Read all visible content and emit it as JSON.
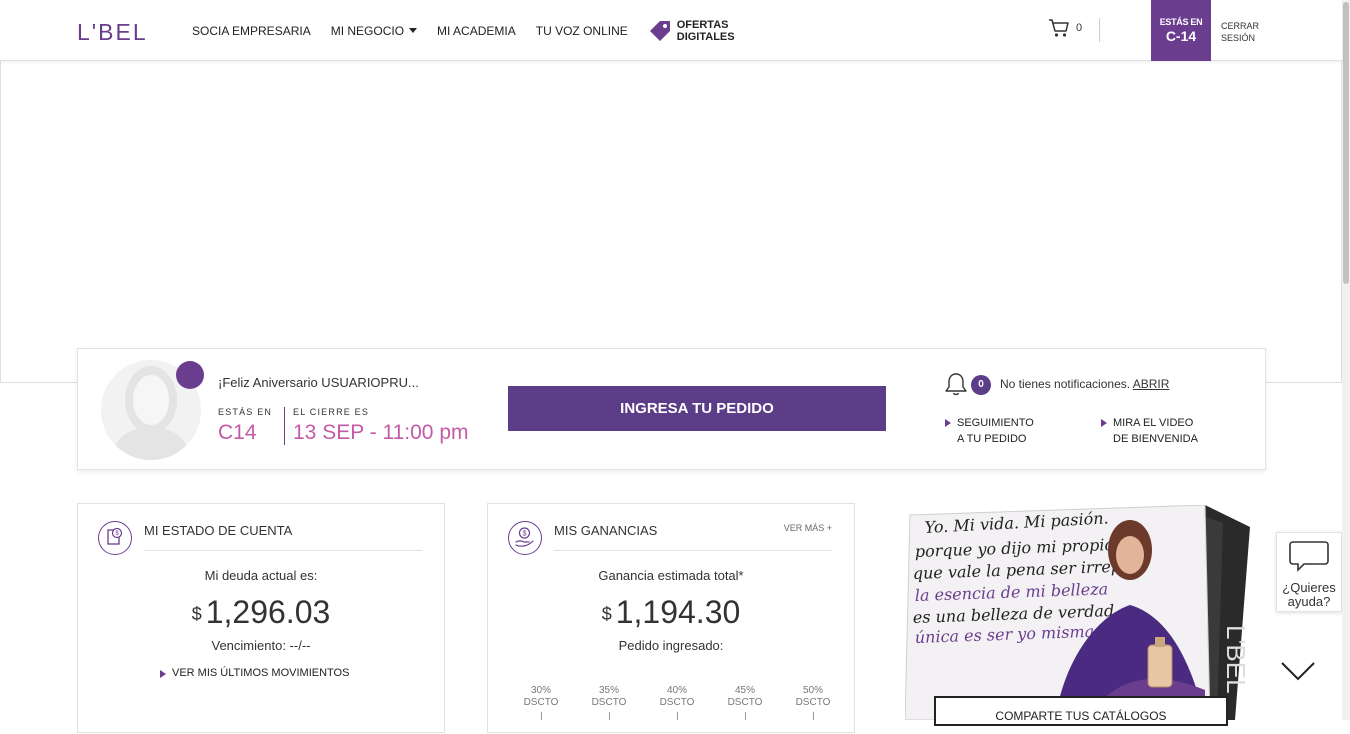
{
  "header": {
    "logo": "L'BEL",
    "nav": {
      "socia": "SOCIA EMPRESARIA",
      "negocio": "MI NEGOCIO",
      "academia": "MI ACADEMIA",
      "voz": "TU VOZ ONLINE",
      "ofertas_line1": "OFERTAS",
      "ofertas_line2": "DIGITALES"
    },
    "cart_count": "0",
    "campaign_label": "ESTÁS EN",
    "campaign_value": "C-14",
    "logout_line1": "CERRAR",
    "logout_line2": "SESIÓN",
    "colors": {
      "brand": "#6a3d8f",
      "accent_pink": "#c45aa5"
    }
  },
  "banner": {
    "slides": 5,
    "active_slide": 1
  },
  "profile": {
    "greeting": "¡Feliz Aniversario USUARIOPRU...",
    "estas_en_label": "ESTÁS EN",
    "campaign": "C14",
    "cierre_label": "EL CIERRE ES",
    "cierre_value": "13 SEP - 11:00 pm",
    "order_button": "INGRESA TU PEDIDO",
    "notif_count": "0",
    "notif_text": "No tienes notificaciones.",
    "notif_link": "ABRIR",
    "link_seguimiento_1": "SEGUIMIENTO",
    "link_seguimiento_2": "A TU PEDIDO",
    "link_video_1": "MIRA EL VIDEO",
    "link_video_2": "DE BIENVENIDA"
  },
  "estado": {
    "title": "MI ESTADO DE CUENTA",
    "debt_label": "Mi deuda actual es:",
    "currency": "$",
    "amount": "1,296.03",
    "due": "Vencimiento: --/--",
    "moves_link": "VER MIS ÚLTIMOS MOVIMIENTOS"
  },
  "ganancias": {
    "title": "MIS GANANCIAS",
    "more": "VER MÁS +",
    "estimate_label": "Ganancia estimada total*",
    "currency": "$",
    "amount": "1,194.30",
    "order_label": "Pedido ingresado:",
    "discounts": [
      {
        "pct": "30%",
        "label": "DSCTO"
      },
      {
        "pct": "35%",
        "label": "DSCTO"
      },
      {
        "pct": "40%",
        "label": "DSCTO"
      },
      {
        "pct": "45%",
        "label": "DSCTO"
      },
      {
        "pct": "50%",
        "label": "DSCTO"
      }
    ]
  },
  "catalog": {
    "button": "COMPARTE TUS CATÁLOGOS",
    "handwriting": [
      "Yo. Mi vida. Mi pasión.",
      "porque yo dijo mi propio",
      "que vale la pena ser irrepe",
      "la esencia de mi belleza",
      "es una belleza de verdad",
      "única es ser yo misma"
    ],
    "cover_letters": "L'BEL"
  },
  "help": {
    "line1": "¿Quieres",
    "line2": "ayuda?"
  }
}
